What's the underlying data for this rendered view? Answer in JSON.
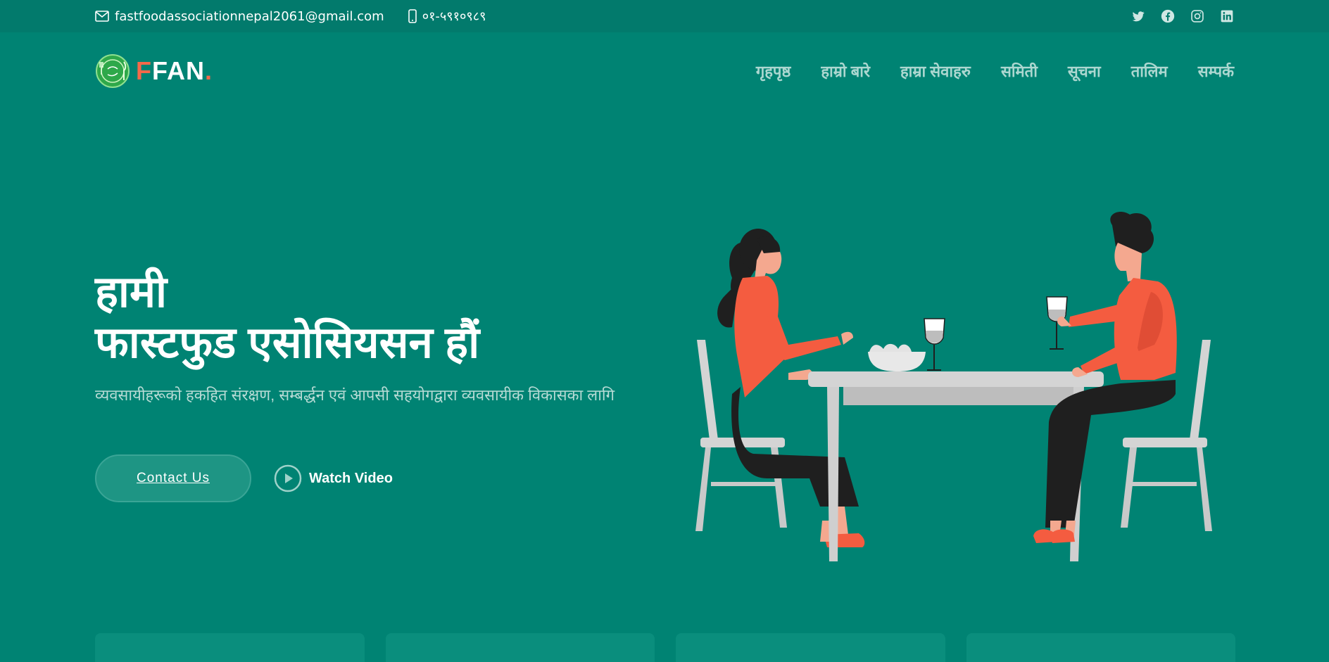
{
  "topbar": {
    "email": "fastfoodassociationnepal2061@gmail.com",
    "phone": "०१-५९१०९८९",
    "social": [
      "twitter-icon",
      "facebook-icon",
      "instagram-icon",
      "linkedin-icon"
    ]
  },
  "brand": {
    "first": "F",
    "rest": "FAN",
    "dot": "."
  },
  "nav": {
    "items": [
      "गृहपृष्ठ",
      "हाम्रो बारे",
      "हाम्रा सेवाहरु",
      "समिती",
      "सूचना",
      "तालिम",
      "सम्पर्क"
    ]
  },
  "hero": {
    "title_line1": "हामी",
    "title_line2": "फास्टफुड एसोसियसन हौं",
    "subtitle": "व्यवसायीहरूको हकहित संरक्षण, सम्बर्द्धन एवं आपसी सहयोगद्वारा व्यवसायीक विकासका लागि",
    "contact_button": "Contact Us",
    "video_button": "Watch Video"
  },
  "colors": {
    "background": "#008373",
    "topbar": "#027a6c",
    "accent": "#f4694a"
  }
}
